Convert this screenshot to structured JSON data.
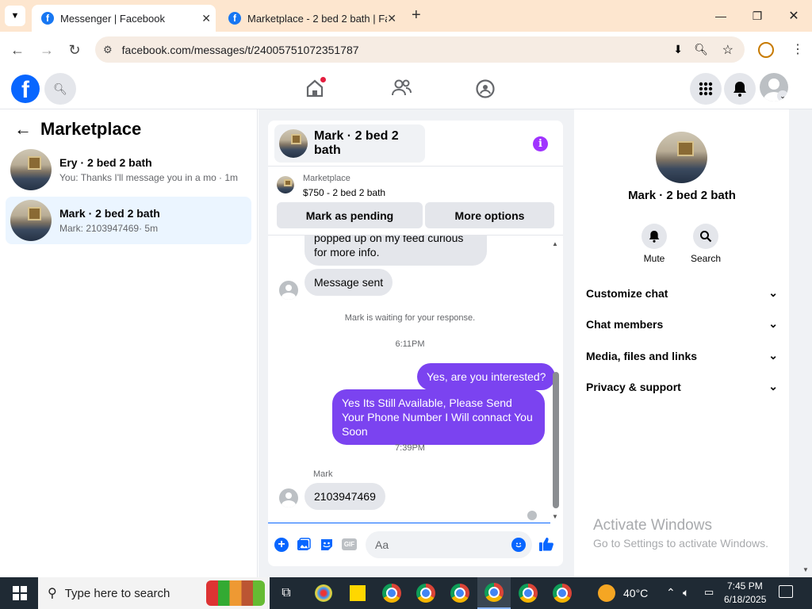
{
  "browser": {
    "tabs": [
      {
        "title": "Messenger | Facebook",
        "active": true
      },
      {
        "title": "Marketplace - 2 bed 2 bath | Fa",
        "active": false
      }
    ],
    "url": "facebook.com/messages/t/24005751072351787"
  },
  "sidebar": {
    "title": "Marketplace",
    "conversations": [
      {
        "name": "Ery · 2 bed 2 bath",
        "preview": "You: Thanks I'll message you in a mo...",
        "time": "· 1m"
      },
      {
        "name": "Mark · 2 bed 2 bath",
        "preview": "Mark: 2103947469",
        "time": "· 5m"
      }
    ]
  },
  "chat": {
    "header_name": "Mark · 2 bed 2 bath",
    "listing_source": "Marketplace",
    "listing_title": "$750 - 2 bed 2 bath",
    "btn_pending": "Mark as pending",
    "btn_more": "More options",
    "msg_partial": "popped up on my feed curious for more info.",
    "msg_sent": "Message sent",
    "waiting_notice": "Mark is waiting for your response.",
    "time1": "6:11PM",
    "my_msg1": "Yes, are you interested?",
    "my_msg2": "Yes Its Still Available, Please Send Your Phone Number I Will connact You Soon",
    "time2": "7:39PM",
    "sender_label": "Mark",
    "their_msg": "2103947469",
    "composer_placeholder": "Aa",
    "gif_label": "GIF"
  },
  "details": {
    "name": "Mark · 2 bed 2 bath",
    "mute_label": "Mute",
    "search_label": "Search",
    "sections": [
      "Customize chat",
      "Chat members",
      "Media, files and links",
      "Privacy & support"
    ]
  },
  "watermark": {
    "title": "Activate Windows",
    "subtitle": "Go to Settings to activate Windows."
  },
  "taskbar": {
    "search_placeholder": "Type here to search",
    "weather": "40°C",
    "time": "7:45 PM",
    "date": "6/18/2025"
  },
  "colors": {
    "accent": "#0866ff",
    "bubble_mine": "#7b43f0",
    "selected_row": "#ebf5ff"
  }
}
